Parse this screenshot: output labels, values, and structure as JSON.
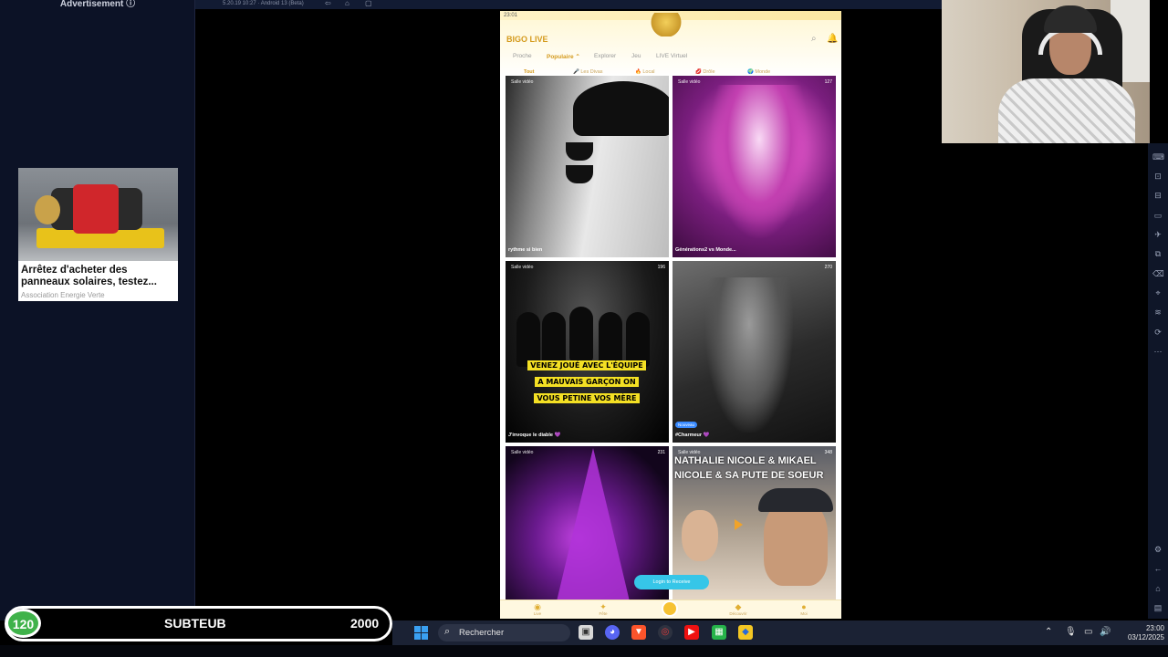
{
  "advertisement": {
    "label": "Advertisement ⓘ",
    "title": "Arrêtez d'acheter des panneaux solaires, testez...",
    "source": "Association Energie Verte"
  },
  "background_window": {
    "app_version": "5.20.19 10:27 · Android 13 (Beta)",
    "icons": [
      "back-icon",
      "home-icon",
      "window-icon"
    ]
  },
  "phone": {
    "status_time": "23:01",
    "brand": "BIGO LIVE",
    "header_icons": [
      "search-icon",
      "bell-icon"
    ],
    "nav_tabs": [
      "Proche",
      "Populaire ⌃",
      "Explorer",
      "Jeu",
      "LIVE Virtuel"
    ],
    "nav_active": "Populaire ⌃",
    "chips": [
      "Tout",
      "🎤 Les Divas",
      "🔥 Local",
      "💋 Drôle",
      "🌍 Monde"
    ],
    "tiles": [
      {
        "tag": "Salle vidéo",
        "count": "",
        "name": "rythme si bien"
      },
      {
        "tag": "Salle vidéo",
        "count": "127",
        "name": "Générations2 vs Monde..."
      },
      {
        "tag": "Salle vidéo",
        "count": "196",
        "name": "J'invoque le diable 💜",
        "overlay": [
          "VENEZ JOUÉ AVEC L'ÉQUIPE",
          "A MAUVAIS GARÇON ON",
          "VOUS PETINE VOS MÈRE"
        ]
      },
      {
        "tag": "",
        "count": "270",
        "name": "#Charmeur 💜",
        "badge": "Nouveau"
      },
      {
        "tag": "Salle vidéo",
        "count": "231",
        "name": ""
      },
      {
        "tag": "Salle vidéo",
        "count": "348",
        "name": "",
        "overlay": "NATHALIE NICOLE & MIKAEL NICOLE & SA PUTE DE SOEUR"
      }
    ],
    "login_pill": "Login to Receive",
    "bottom_nav": [
      "Live",
      "Fête",
      "",
      "Découvrir",
      "Moi"
    ]
  },
  "progress": {
    "current": "120",
    "label": "SUBTEUB",
    "goal": "2000",
    "fraction": 0.06
  },
  "taskbar": {
    "search_placeholder": "Rechercher",
    "time": "23:00",
    "date": "03/12/2025",
    "apps": [
      "file-explorer-icon",
      "discord-icon",
      "brave-icon",
      "chrome-icon",
      "youtube-icon",
      "spreadsheet-icon",
      "bluestacks-icon"
    ],
    "tray": [
      "chevron-up-icon",
      "mic-icon",
      "display-icon",
      "volume-icon"
    ]
  },
  "right_toolbar": {
    "icons": [
      "keyboard-icon",
      "screenshot-icon",
      "record-icon",
      "folder-icon",
      "airplane-icon",
      "resize-icon",
      "erase-icon",
      "location-icon",
      "layers-icon",
      "sync-icon",
      "more-icon",
      "settings-icon",
      "back-icon",
      "home-icon",
      "recent-icon"
    ]
  },
  "colors": {
    "brand": "#d49a1c",
    "progress_green": "#3fb24a",
    "taskbar": "#1b2234"
  }
}
